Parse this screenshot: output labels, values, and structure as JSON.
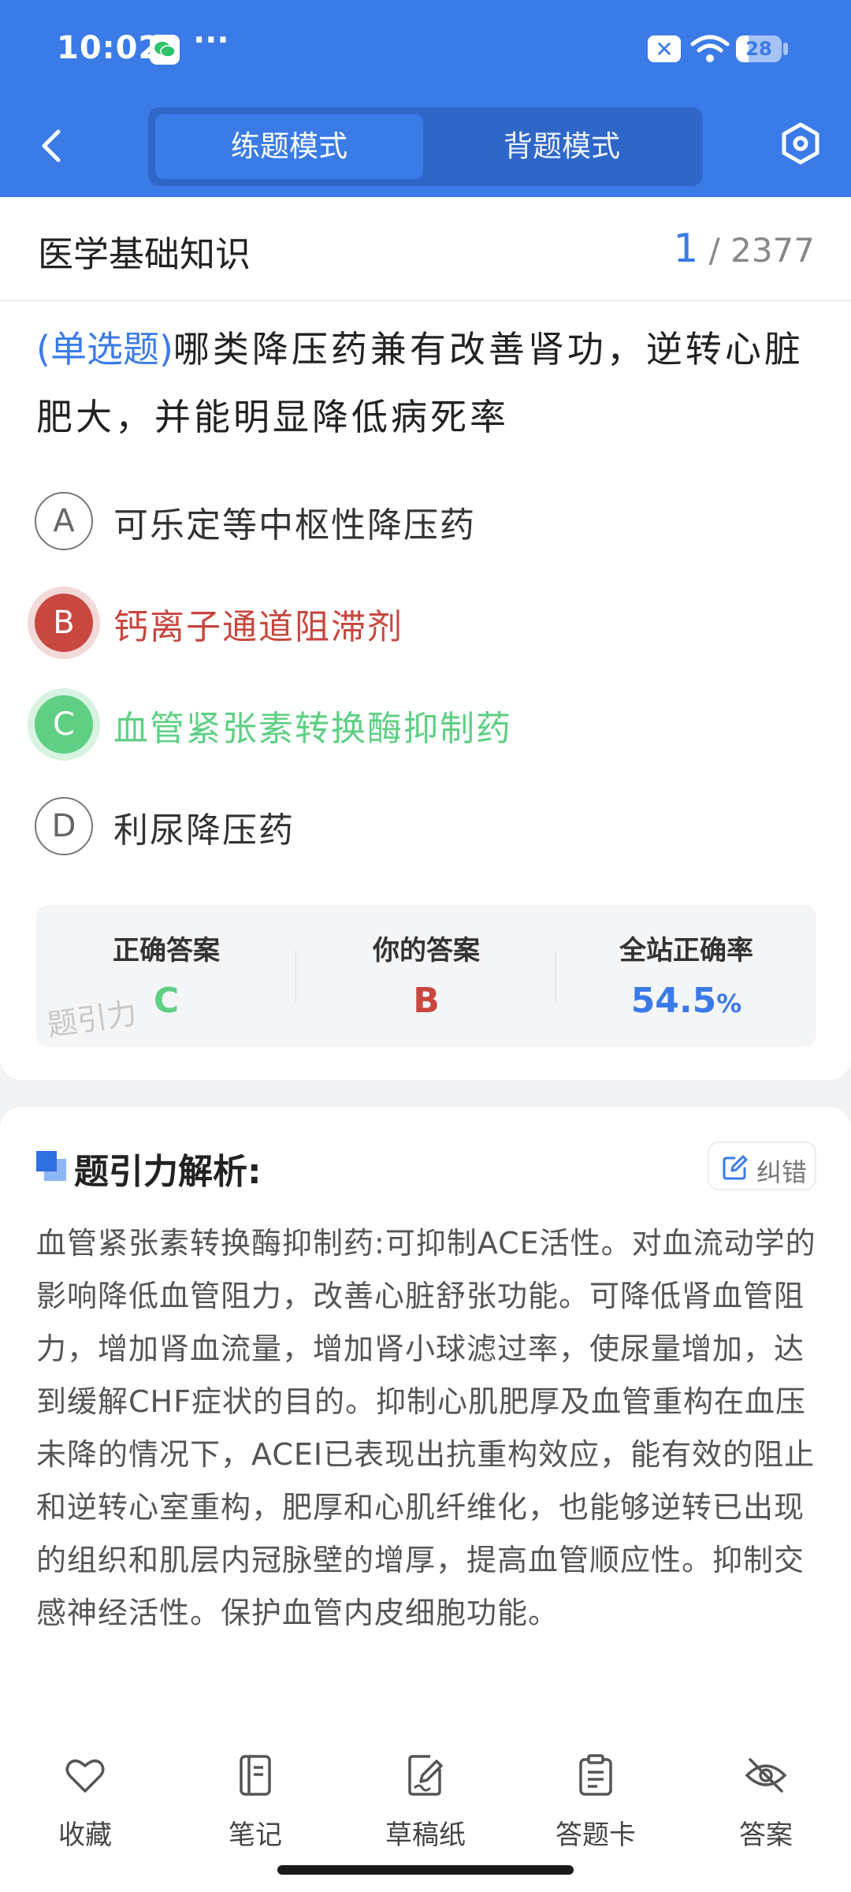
{
  "status_bar": {
    "time": "10:02",
    "dots": "···",
    "battery": "28",
    "battery_level": 0.28
  },
  "header": {
    "tabs": [
      {
        "label": "练题模式",
        "active": true
      },
      {
        "label": "背题模式",
        "active": false
      }
    ]
  },
  "subject": {
    "title": "医学基础知识",
    "current": "1",
    "total": "/ 2377"
  },
  "question": {
    "type": "(单选题)",
    "text": "哪类降压药兼有改善肾功，逆转心脏肥大，并能明显降低病死率"
  },
  "options": [
    {
      "letter": "A",
      "text": "可乐定等中枢性降压药",
      "state": "normal"
    },
    {
      "letter": "B",
      "text": "钙离子通道阻滞剂",
      "state": "wrong"
    },
    {
      "letter": "C",
      "text": "血管紧张素转换酶抑制药",
      "state": "right"
    },
    {
      "letter": "D",
      "text": "利尿降压药",
      "state": "normal"
    }
  ],
  "stats": {
    "correct_label": "正确答案",
    "correct_value": "C",
    "yours_label": "你的答案",
    "yours_value": "B",
    "rate_label": "全站正确率",
    "rate_value": "54.5",
    "rate_unit": "%",
    "watermark": "题引力"
  },
  "analysis": {
    "title": "题引力解析:",
    "correct_button": "纠错",
    "text": "血管紧张素转换酶抑制药:可抑制ACE活性。对血流动学的影响降低血管阻力，改善心脏舒张功能。可降低肾血管阻力，增加肾血流量，增加肾小球滤过率，使尿量增加，达到缓解CHF症状的目的。抑制心肌肥厚及血管重构在血压未降的情况下，ACEI已表现出抗重构效应，能有效的阻止和逆转心室重构，肥厚和心肌纤维化，也能够逆转已出现的组织和肌层内冠脉壁的增厚，提高血管顺应性。抑制交感神经活性。保护血管内皮细胞功能。"
  },
  "bottom_bar": [
    {
      "label": "收藏",
      "icon": "heart-icon"
    },
    {
      "label": "笔记",
      "icon": "notebook-icon"
    },
    {
      "label": "草稿纸",
      "icon": "draft-icon"
    },
    {
      "label": "答题卡",
      "icon": "clipboard-icon"
    },
    {
      "label": "答案",
      "icon": "eye-off-icon"
    }
  ],
  "colors": {
    "brand": "#3b7be8",
    "wrong": "#c8473f",
    "right": "#5fcf84"
  }
}
